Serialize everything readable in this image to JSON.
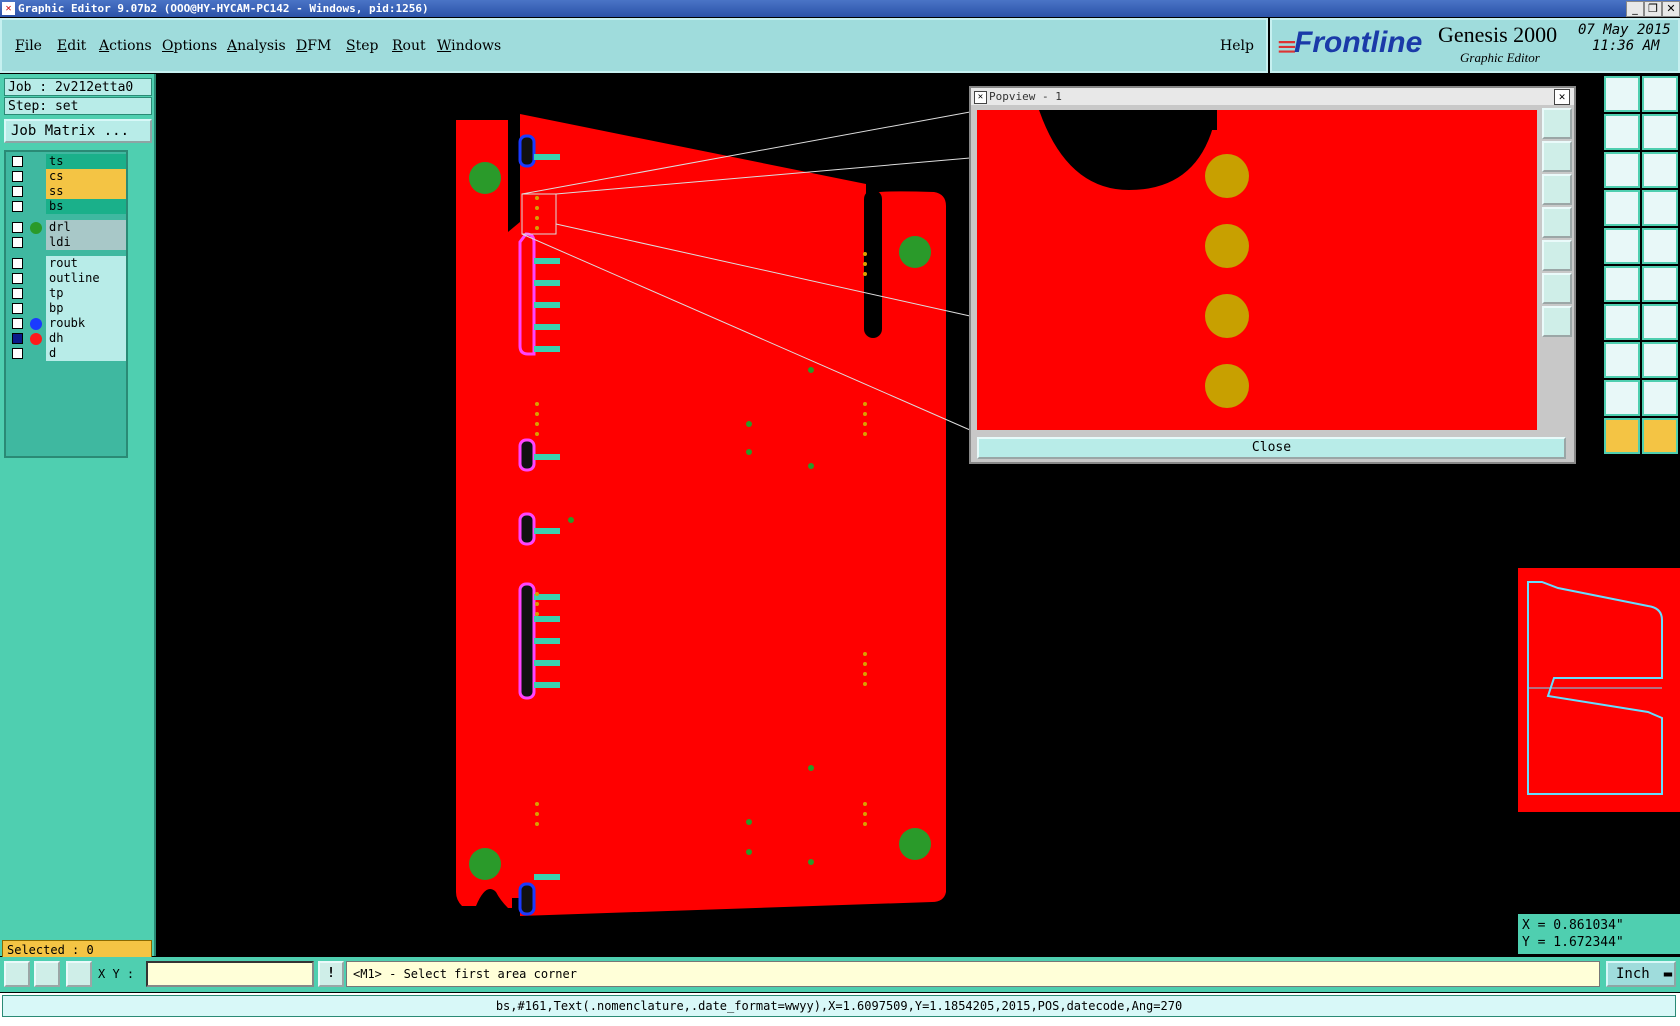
{
  "window": {
    "title": "Graphic Editor 9.07b2 (OOO@HY-HYCAM-PC142 - Windows, pid:1256)"
  },
  "menu": {
    "items": [
      {
        "key": "F",
        "rest": "ile"
      },
      {
        "key": "E",
        "rest": "dit"
      },
      {
        "key": "A",
        "rest": "ctions"
      },
      {
        "key": "O",
        "rest": "ptions"
      },
      {
        "key": "A",
        "rest": "nalysis"
      },
      {
        "key": "D",
        "rest": "FM"
      },
      {
        "key": "S",
        "rest": "tep"
      },
      {
        "key": "R",
        "rest": "out"
      },
      {
        "key": "W",
        "rest": "indows"
      }
    ],
    "help": "Help"
  },
  "brand": {
    "logo": "Frontline",
    "product": "Genesis 2000",
    "subtitle": "Graphic Editor",
    "date": "07 May 2015",
    "time": "11:36 AM"
  },
  "job": {
    "job_label": "Job : 2v212etta0",
    "step_label": "Step: set",
    "matrix_button": "Job Matrix ..."
  },
  "layers": [
    {
      "name": "ts",
      "color": "#1ab08a",
      "dot": "",
      "checked": false
    },
    {
      "name": "cs",
      "color": "#f4c444",
      "dot": "",
      "checked": false
    },
    {
      "name": "ss",
      "color": "#f4c444",
      "dot": "",
      "checked": false
    },
    {
      "name": "bs",
      "color": "#1ab08a",
      "dot": "",
      "checked": false
    },
    {
      "name": "drl",
      "color": "#a8c8c8",
      "dot": "#2a9a2a",
      "checked": false
    },
    {
      "name": "ldi",
      "color": "#a8c8c8",
      "dot": "",
      "checked": false
    },
    {
      "name": "rout",
      "color": "#b8ece8",
      "dot": "",
      "checked": false
    },
    {
      "name": "outline",
      "color": "#b8ece8",
      "dot": "",
      "checked": false
    },
    {
      "name": "tp",
      "color": "#b8ece8",
      "dot": "",
      "checked": false
    },
    {
      "name": "bp",
      "color": "#b8ece8",
      "dot": "",
      "checked": false
    },
    {
      "name": "roubk",
      "color": "#b8ece8",
      "dot": "#1a3aff",
      "checked": false
    },
    {
      "name": "dh",
      "color": "#b8ece8",
      "dot": "#ff1a1a",
      "checked": true
    },
    {
      "name": "d",
      "color": "#b8ece8",
      "dot": "",
      "checked": false
    }
  ],
  "selected_label": "Selected : 0",
  "popview": {
    "title": "Popview - 1",
    "close_label": "Close"
  },
  "cmd": {
    "xy_label": "X Y :",
    "xy_value": "",
    "prompt": "<M1> - Select first area corner",
    "units": "Inch"
  },
  "coords": {
    "x": "X = 0.861034\"",
    "y": "Y = 1.672344\""
  },
  "status_text": "bs,#161,Text(.nomenclature,.date_format=wwyy),X=1.6097509,Y=1.1854205,2015,POS,datecode,Ang=270",
  "colors": {
    "board": "#ff0000",
    "canvas": "#000000",
    "panel": "#4fcfb0",
    "menu": "#9fdcdc",
    "pad": "#c8a000",
    "drill": "#2a9a2a"
  }
}
